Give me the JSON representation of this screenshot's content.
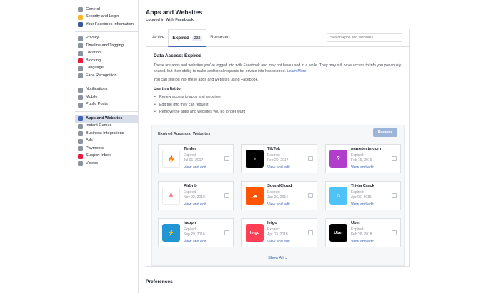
{
  "sidebar": {
    "groups": [
      [
        {
          "label": "General",
          "icon": "gear-icon",
          "color": "#8d949e"
        },
        {
          "label": "Security and Login",
          "icon": "shield-icon",
          "color": "#f7b928"
        },
        {
          "label": "Your Facebook Information",
          "icon": "facebook-icon",
          "color": "#3b5998"
        }
      ],
      [
        {
          "label": "Privacy",
          "icon": "lock-icon",
          "color": "#8d949e"
        },
        {
          "label": "Timeline and Tagging",
          "icon": "timeline-icon",
          "color": "#8d949e"
        },
        {
          "label": "Location",
          "icon": "location-icon",
          "color": "#8d949e"
        },
        {
          "label": "Blocking",
          "icon": "blocking-icon",
          "color": "#e41e3f"
        },
        {
          "label": "Language",
          "icon": "language-icon",
          "color": "#8d949e"
        },
        {
          "label": "Face Recognition",
          "icon": "face-recognition-icon",
          "color": "#8d949e"
        }
      ],
      [
        {
          "label": "Notifications",
          "icon": "globe-icon",
          "color": "#8d949e"
        },
        {
          "label": "Mobile",
          "icon": "mobile-icon",
          "color": "#8d949e"
        },
        {
          "label": "Public Posts",
          "icon": "public-posts-icon",
          "color": "#8d949e"
        }
      ],
      [
        {
          "label": "Apps and Websites",
          "icon": "apps-icon",
          "color": "#4267b2",
          "active": true
        },
        {
          "label": "Instant Games",
          "icon": "games-icon",
          "color": "#8d949e"
        },
        {
          "label": "Business Integrations",
          "icon": "business-icon",
          "color": "#8d949e"
        },
        {
          "label": "Ads",
          "icon": "ads-icon",
          "color": "#8d949e"
        },
        {
          "label": "Payments",
          "icon": "payments-icon",
          "color": "#8d949e"
        },
        {
          "label": "Support Inbox",
          "icon": "support-icon",
          "color": "#e41e3f"
        },
        {
          "label": "Videos",
          "icon": "videos-icon",
          "color": "#8d949e"
        }
      ]
    ]
  },
  "header": {
    "title": "Apps and Websites",
    "subtitle": "Logged in With Facebook"
  },
  "tabs": {
    "active": "Active",
    "expired": "Expired",
    "expired_count": "232",
    "removed": "Removed"
  },
  "search": {
    "placeholder": "Search Apps and Websites"
  },
  "info": {
    "title": "Data Access: Expired",
    "paragraph1": "These are apps and websites you've logged into with Facebook and may not have used in a while. They may still have access to info you previously shared, but their ability to make additional requests for private info has expired.",
    "learn_more": "Learn More",
    "paragraph2": "You can still log into these apps and websites using Facebook.",
    "use_title": "Use this list to:",
    "bullets": [
      "Renew access to apps and websites",
      "Edit the info they can request",
      "Remove the apps and websites you no longer want"
    ]
  },
  "expired_section": {
    "title": "Expired Apps and Websites",
    "remove_label": "Remove",
    "expired_label": "Expired:",
    "view_label": "View and edit",
    "show_all": "Show All",
    "apps": [
      {
        "name": "Tinder",
        "date": "Jul 01, 2017",
        "icon": "tinder-flame-icon",
        "bg": "#ffffff",
        "fg": "#fd5068",
        "glyph": "🔥"
      },
      {
        "name": "TikTok",
        "date": "Feb 20, 2017",
        "icon": "tiktok-note-icon",
        "bg": "#010101",
        "fg": "#ffffff",
        "glyph": "♪"
      },
      {
        "name": "nametests.com",
        "date": "Feb 19, 2019",
        "icon": "nametests-icon",
        "bg": "#b13ecb",
        "fg": "#ffffff",
        "glyph": "?"
      },
      {
        "name": "Airbnb",
        "date": "Nov 02, 2018",
        "icon": "airbnb-icon",
        "bg": "#ffffff",
        "fg": "#ff5a5f",
        "glyph": "A"
      },
      {
        "name": "SoundCloud",
        "date": "Jan 06, 2014",
        "icon": "soundcloud-icon",
        "bg": "#ff5500",
        "fg": "#ffffff",
        "glyph": "☁"
      },
      {
        "name": "Trivia Crack",
        "date": "Apr 06, 2015",
        "icon": "trivia-crack-icon",
        "bg": "#4fc3f7",
        "fg": "#ffffff",
        "glyph": "☺"
      },
      {
        "name": "happn",
        "date": "Sep 29, 2016",
        "icon": "happn-icon",
        "bg": "#2196d3",
        "fg": "#ffffff",
        "glyph": "⚡"
      },
      {
        "name": "letgo",
        "date": "Apr 03, 2018",
        "icon": "letgo-icon",
        "bg": "#ff3f55",
        "fg": "#ffffff",
        "glyph": "letgo"
      },
      {
        "name": "Uber",
        "date": "Feb 26, 2018",
        "icon": "uber-icon",
        "bg": "#000000",
        "fg": "#ffffff",
        "glyph": "Uber"
      }
    ]
  },
  "preferences": {
    "title": "Preferences"
  }
}
